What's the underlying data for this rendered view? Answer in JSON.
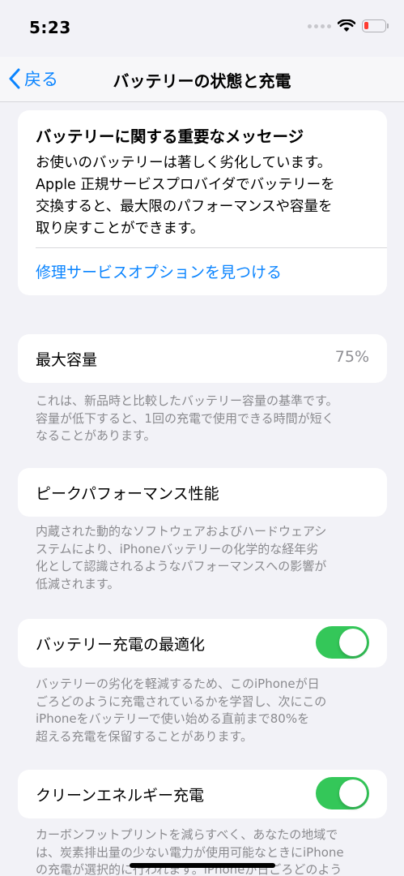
{
  "status_bar": {
    "time": "5:23",
    "wifi_icon": "wifi-icon",
    "battery_icon": "battery-low-icon"
  },
  "nav": {
    "back_label": "戻る",
    "title": "バッテリーの状態と充電"
  },
  "message": {
    "title": "バッテリーに関する重要なメッセージ",
    "body": "お使いのバッテリーは著しく劣化しています。Apple正規サービスプロバイダでバッテリーを交換すると、最大限のパフォーマンスや容量を取り戻すことができます。",
    "body_lines": [
      "お使いのバッテリーは著しく劣化しています。",
      "Apple 正規サービスプロバイダでバッテリーを",
      "交換すると、最大限のパフォーマンスや容量を",
      "取り戻すことができます。"
    ],
    "link": "修理サービスオプションを見つける"
  },
  "max_capacity": {
    "label": "最大容量",
    "value": "75%",
    "footnote_lines": [
      "これは、新品時と比較したバッテリー容量の基準です。",
      "容量が低下すると、1回の充電で使用できる時間が短く",
      "なることがあります。"
    ]
  },
  "peak_performance": {
    "label": "ピークパフォーマンス性能",
    "footnote_lines": [
      "内蔵された動的なソフトウェアおよびハードウェアシ",
      "ステムにより、iPhoneバッテリーの化学的な経年劣",
      "化として認識されるようなパフォーマンスへの影響が",
      "低減されます。"
    ]
  },
  "optimized_charging": {
    "label": "バッテリー充電の最適化",
    "enabled": true,
    "footnote_lines": [
      "バッテリーの劣化を軽減するため、このiPhoneが日",
      "ごろどのように充電されているかを学習し、次にこの",
      "iPhoneをバッテリーで使い始める直前まで80%を",
      "超える充電を保留することがあります。"
    ]
  },
  "clean_energy": {
    "label": "クリーンエネルギー充電",
    "enabled": true,
    "footnote_lines": [
      "カーボンフットプリントを減らすべく、あなたの地域で",
      "は、炭素排出量の少ない電力が使用可能なときにiPhone",
      "の充電が選択的に行われます。iPhoneが日ごろどのよう"
    ]
  },
  "colors": {
    "accent": "#0a84ff",
    "toggle_on": "#34c759",
    "background": "#f2f2f7"
  }
}
